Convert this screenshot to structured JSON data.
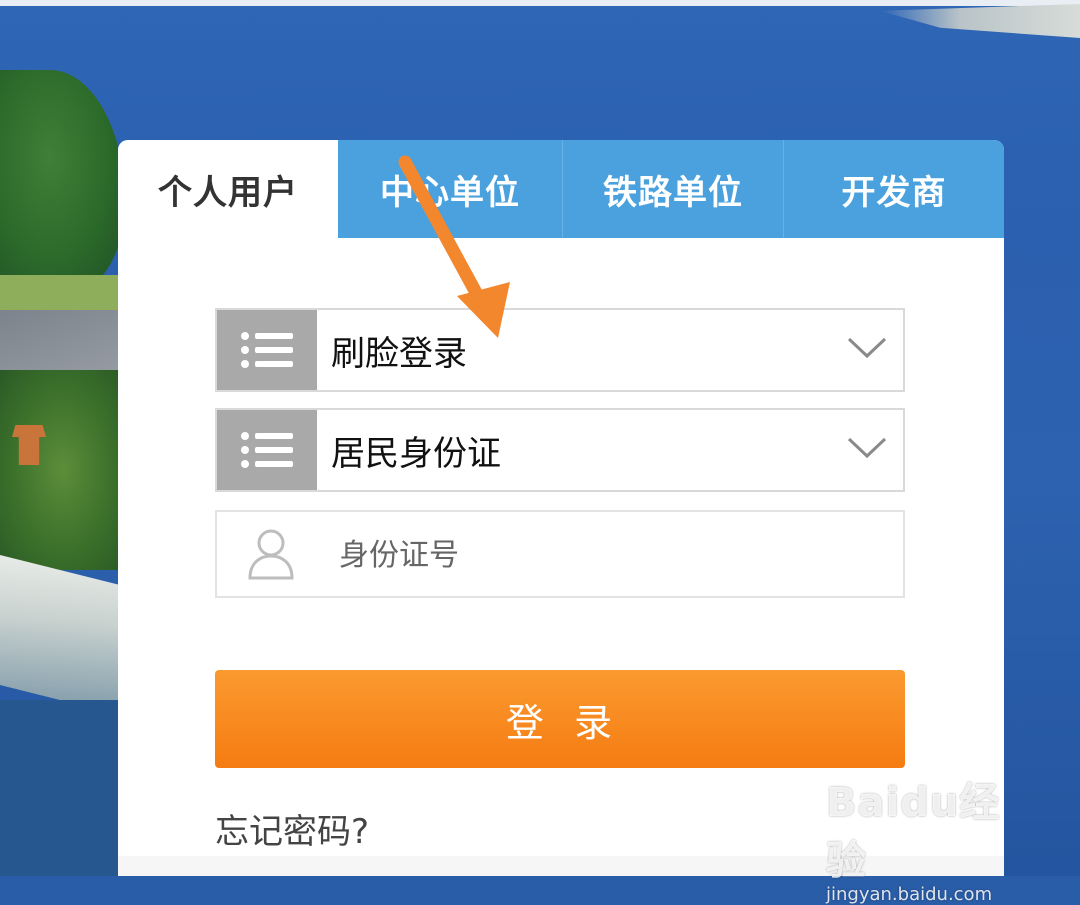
{
  "tabs": [
    {
      "label": "个人用户",
      "active": true
    },
    {
      "label": "中心单位",
      "active": false
    },
    {
      "label": "铁路单位",
      "active": false
    },
    {
      "label": "开发商",
      "active": false
    }
  ],
  "login_method_select": {
    "value": "刷脸登录",
    "icon": "list-icon"
  },
  "id_type_select": {
    "value": "居民身份证",
    "icon": "list-icon"
  },
  "id_number_input": {
    "placeholder": "身份证号",
    "value": "",
    "icon": "user-icon"
  },
  "login_button": {
    "label": "登  录"
  },
  "forgot_password": {
    "label": "忘记密码?"
  },
  "watermark": {
    "logo": "Baidu经验",
    "url": "jingyan.baidu.com"
  },
  "colors": {
    "tab_bar": "#4aa1de",
    "login_button": "#f7861a",
    "annotation_arrow": "#f2872e",
    "icon_block": "#a9a9a9"
  }
}
